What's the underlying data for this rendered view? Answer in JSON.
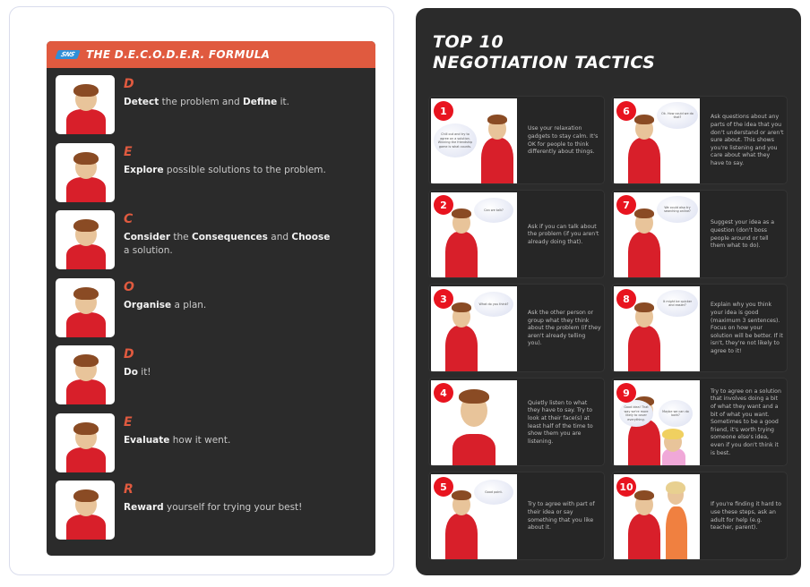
{
  "decoder": {
    "logo_text": "SNS",
    "title": "THE D.E.C.O.D.E.R. FORMULA",
    "accent_color": "#e05a3f",
    "steps": [
      {
        "letter": "D",
        "parts": [
          {
            "t": "Detect",
            "b": true
          },
          {
            "t": " the problem and ",
            "b": false
          },
          {
            "t": "Define",
            "b": true
          },
          {
            "t": " it.",
            "b": false
          }
        ],
        "image": "boy-with-binoculars"
      },
      {
        "letter": "E",
        "parts": [
          {
            "t": "Explore",
            "b": true
          },
          {
            "t": " possible solutions to the problem.",
            "b": false
          }
        ],
        "image": "group-at-table"
      },
      {
        "letter": "C",
        "parts": [
          {
            "t": "Consider",
            "b": true
          },
          {
            "t": " the ",
            "b": false
          },
          {
            "t": "Consequences",
            "b": true
          },
          {
            "t": " and ",
            "b": false
          },
          {
            "t": "Choose",
            "b": true
          },
          {
            "t": " a solution.",
            "b": false
          }
        ],
        "image": "boy-raising-finger"
      },
      {
        "letter": "O",
        "parts": [
          {
            "t": "Organise",
            "b": true
          },
          {
            "t": " a plan.",
            "b": false
          }
        ],
        "image": "boy-at-whiteboard"
      },
      {
        "letter": "D",
        "parts": [
          {
            "t": "Do",
            "b": true
          },
          {
            "t": " it!",
            "b": false
          }
        ],
        "image": "kids-at-laptop"
      },
      {
        "letter": "E",
        "parts": [
          {
            "t": "Evaluate",
            "b": true
          },
          {
            "t": " how it went.",
            "b": false
          }
        ],
        "image": "boy-with-checklist"
      },
      {
        "letter": "R",
        "parts": [
          {
            "t": "Reward",
            "b": true
          },
          {
            "t": " yourself for trying your best!",
            "b": false
          }
        ],
        "image": "boy-with-game-controller"
      }
    ]
  },
  "tactics": {
    "title_line1": "TOP 10",
    "title_line2": "NEGOTIATION TACTICS",
    "badge_color": "#e8141f",
    "items": [
      {
        "num": "1",
        "bubble": "Chill out and try to agree on a solution. Winning the friendship game is what counts.",
        "text": "Use your relaxation gadgets to stay calm. It's OK for people to think differently about things."
      },
      {
        "num": "2",
        "bubble": "Can we talk?",
        "text": "Ask if you can talk about the problem (if you aren't already doing that)."
      },
      {
        "num": "3",
        "bubble": "What do you think?",
        "text": "Ask the other person or group what they think about the problem (if they aren't already telling you)."
      },
      {
        "num": "4",
        "bubble": "",
        "text": "Quietly listen to what they have to say. Try to look at their face(s) at least half of the time to show them you are listening."
      },
      {
        "num": "5",
        "bubble": "Good point.",
        "text": "Try to agree with part of their idea or say something that you like about it."
      },
      {
        "num": "6",
        "bubble": "Ok. How could we do that?",
        "text": "Ask questions about any parts of the idea that you don't understand or aren't sure about. This shows you're listening and you care about what they have to say."
      },
      {
        "num": "7",
        "bubble": "We could also try searching online?",
        "text": "Suggest your idea as a question (don't boss people around or tell them what to do)."
      },
      {
        "num": "8",
        "bubble": "It might be quicker and easier?",
        "text": "Explain why you think your idea is good (maximum 3 sentences). Focus on how your solution will be better. If it isn't, they're not likely to agree to it!"
      },
      {
        "num": "9",
        "bubble": "Good idea! That way we're more likely to cover everything.",
        "bubble2": "Maybe we can do both?",
        "text": "Try to agree on a solution that involves doing a bit of what they want and a bit of what you want. Sometimes to be a good friend, it's worth trying someone else's idea, even if you don't think it is best."
      },
      {
        "num": "10",
        "bubble": "",
        "text": "If you're finding it hard to use these steps, ask an adult for help (e.g. teacher, parent)."
      }
    ]
  }
}
